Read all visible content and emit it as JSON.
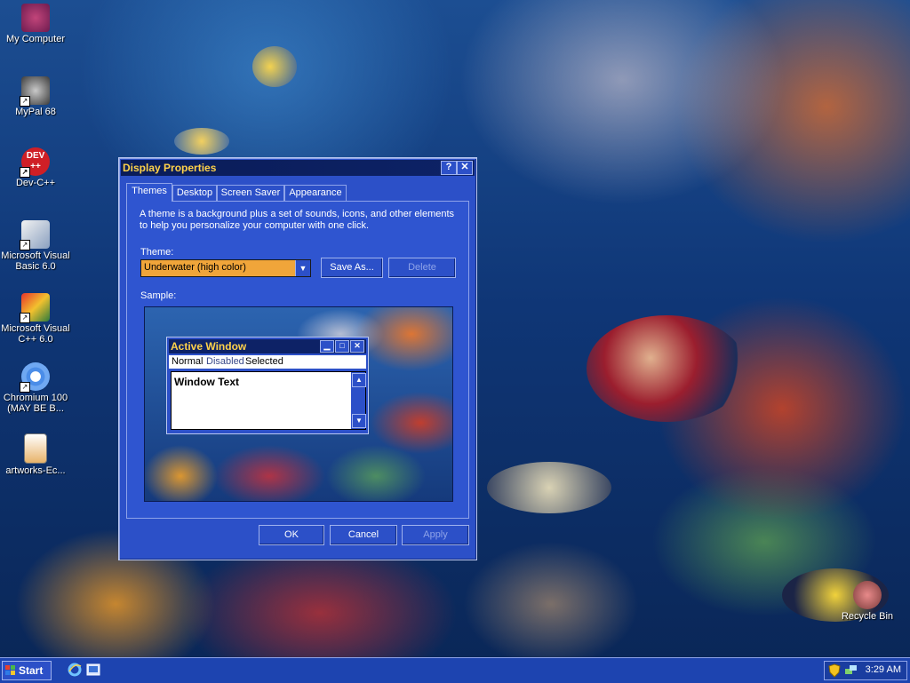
{
  "desktop": {
    "icons": [
      {
        "label": "My Computer",
        "icon": "fish-computer-icon"
      },
      {
        "label": "MyPal 68",
        "icon": "raccoon-browser-icon"
      },
      {
        "label": "Dev-C++",
        "icon": "devcpp-icon"
      },
      {
        "label": "Microsoft Visual Basic 6.0",
        "icon": "vb6-icon"
      },
      {
        "label": "Microsoft Visual C++ 6.0",
        "icon": "vcpp-icon"
      },
      {
        "label": "Chromium 100 (MAY BE B...",
        "icon": "chromium-icon"
      },
      {
        "label": "artworks-Ec...",
        "icon": "image-file-icon"
      },
      {
        "label": "Recycle Bin",
        "icon": "recycle-bin-icon"
      }
    ]
  },
  "dialog": {
    "title": "Display Properties",
    "help_btn": "?",
    "close_btn": "✕",
    "tabs": [
      "Themes",
      "Desktop",
      "Screen Saver",
      "Appearance"
    ],
    "active_tab": "Themes",
    "description": "A theme is a background plus a set of sounds, icons, and other elements to help you personalize your computer with one click.",
    "theme_label": "Theme:",
    "theme_value": "Underwater (high color)",
    "save_as": "Save As...",
    "delete": "Delete",
    "sample_label": "Sample:",
    "sample": {
      "window_title": "Active Window",
      "menu": [
        "Normal",
        "Disabled",
        "Selected"
      ],
      "window_text": "Window Text"
    },
    "ok": "OK",
    "cancel": "Cancel",
    "apply": "Apply"
  },
  "taskbar": {
    "start": "Start",
    "quick_launch": [
      "internet-explorer-icon",
      "show-desktop-icon"
    ],
    "tray_icons": [
      "security-shield-icon",
      "network-icon"
    ],
    "time": "3:29 AM"
  },
  "colors": {
    "dialog_face": "#2c50c8",
    "title_text": "#ffd24a",
    "combo_bg": "#f0a53a",
    "taskbar": "#1d44b0"
  }
}
